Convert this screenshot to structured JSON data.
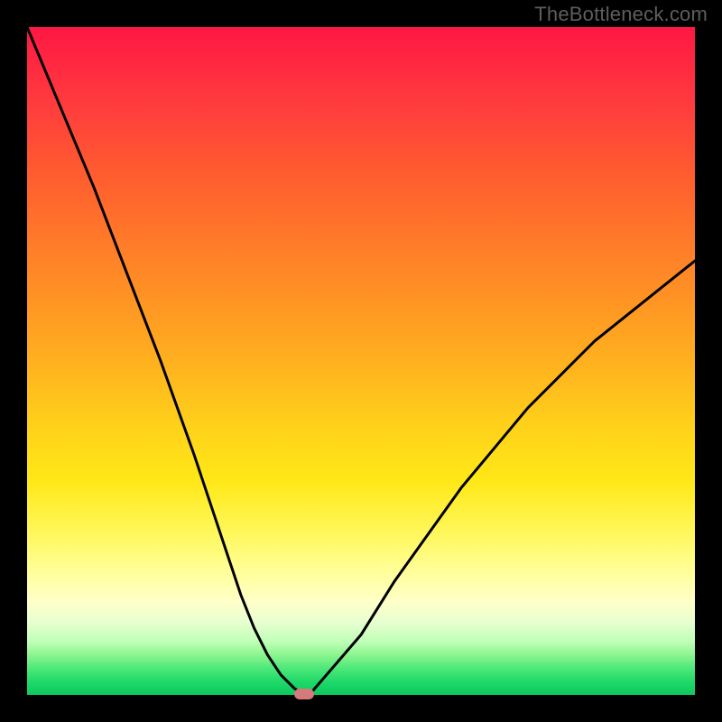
{
  "watermark": "TheBottleneck.com",
  "chart_data": {
    "type": "line",
    "title": "",
    "xlabel": "",
    "ylabel": "",
    "xlim": [
      0,
      100
    ],
    "ylim": [
      0,
      100
    ],
    "grid": false,
    "legend": false,
    "background_gradient_meaning": "bottleneck severity: red = bad, green = good",
    "series": [
      {
        "name": "bottleneck-curve",
        "x": [
          0,
          5,
          10,
          15,
          20,
          25,
          28,
          30,
          32,
          34,
          36,
          38,
          40,
          41.5,
          42.5,
          50,
          55,
          60,
          65,
          70,
          75,
          80,
          85,
          90,
          95,
          100
        ],
        "values": [
          100,
          88,
          76,
          63,
          50,
          36,
          27,
          21,
          15,
          10,
          6,
          3,
          1,
          0,
          0.3,
          9,
          17,
          24,
          31,
          37,
          43,
          48,
          53,
          57,
          61,
          65
        ]
      }
    ],
    "marker": {
      "x": 41.5,
      "y": 0,
      "name": "optimal-point"
    },
    "colors": {
      "curve": "#000000",
      "marker": "#d47a7a",
      "gradient_top": "#ff1744",
      "gradient_bottom": "#0cc85f"
    }
  }
}
